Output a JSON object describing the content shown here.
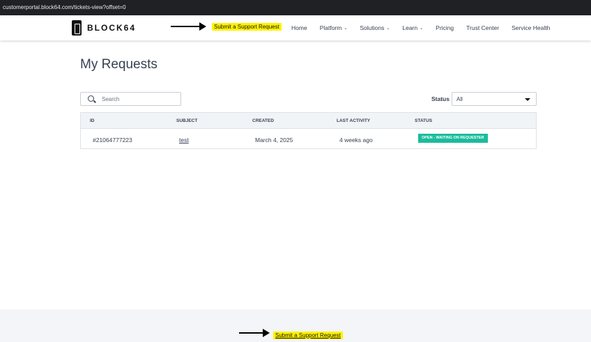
{
  "browser": {
    "url": "customerportal.block64.com/tickets-view?offset=0"
  },
  "header": {
    "logo_text": "BLOCK64",
    "submit_request_label": "Submit a Support Request",
    "nav": [
      {
        "label": "Home",
        "has_dropdown": false
      },
      {
        "label": "Platform",
        "has_dropdown": true
      },
      {
        "label": "Solutions",
        "has_dropdown": true
      },
      {
        "label": "Learn",
        "has_dropdown": true
      },
      {
        "label": "Pricing",
        "has_dropdown": false
      },
      {
        "label": "Trust Center",
        "has_dropdown": false
      },
      {
        "label": "Service Health",
        "has_dropdown": false
      }
    ]
  },
  "main": {
    "title": "My Requests",
    "search_placeholder": "Search",
    "status_label": "Status",
    "status_value": "All",
    "table": {
      "columns": [
        "ID",
        "SUBJECT",
        "CREATED",
        "LAST ACTIVITY",
        "STATUS"
      ],
      "rows": [
        {
          "id": "#21064777223",
          "subject": "test",
          "created": "March 4, 2025",
          "last_activity": "4 weeks ago",
          "status": "OPEN - WAITING ON REQUESTER"
        }
      ]
    }
  },
  "footer": {
    "submit_request_label": "Submit a Support Request"
  },
  "colors": {
    "highlight": "#fff200",
    "status_badge": "#1abc9c",
    "header_bg": "#ffffff",
    "footer_bg": "#f3f5f9"
  },
  "icons": {
    "search": "search-icon",
    "dropdown": "chevron-down-icon"
  }
}
